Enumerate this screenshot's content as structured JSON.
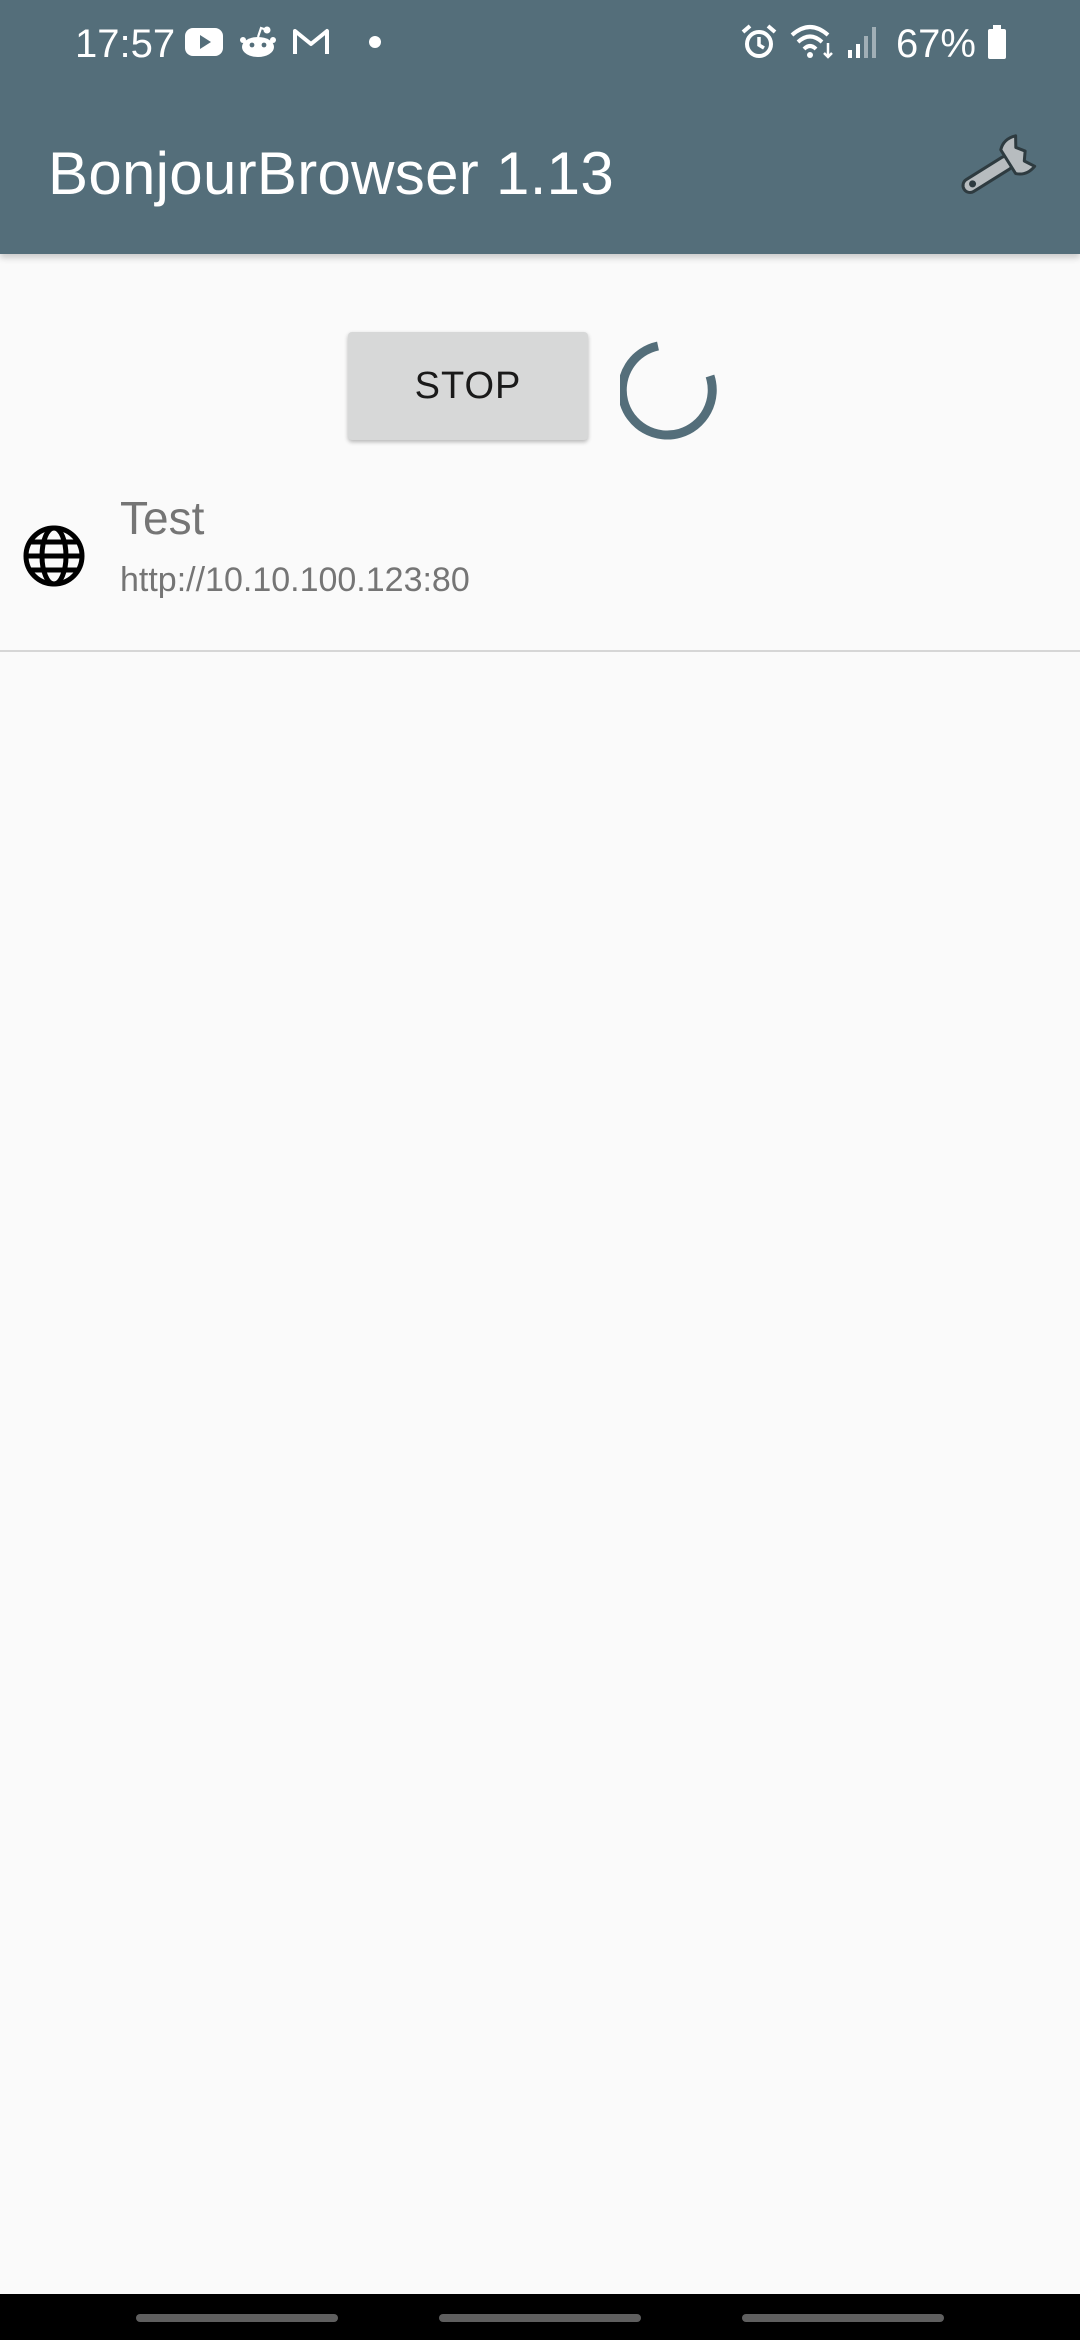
{
  "status_bar": {
    "time": "17:57",
    "battery_percent": "67%",
    "notification_icons": [
      "youtube-icon",
      "reddit-icon",
      "gmail-icon",
      "dot-icon"
    ],
    "system_icons": [
      "alarm-icon",
      "wifi-icon",
      "signal-icon",
      "battery-icon"
    ]
  },
  "app_bar": {
    "title": "BonjourBrowser 1.13",
    "settings_icon": "wrench-icon"
  },
  "controls": {
    "stop_label": "STOP",
    "spinner_color": "#546e7a"
  },
  "services": [
    {
      "name": "Test",
      "url": "http://10.10.100.123:80",
      "icon": "globe-icon"
    }
  ],
  "colors": {
    "primary": "#546e7a",
    "background": "#fafafa",
    "button": "#d7d8d8"
  }
}
